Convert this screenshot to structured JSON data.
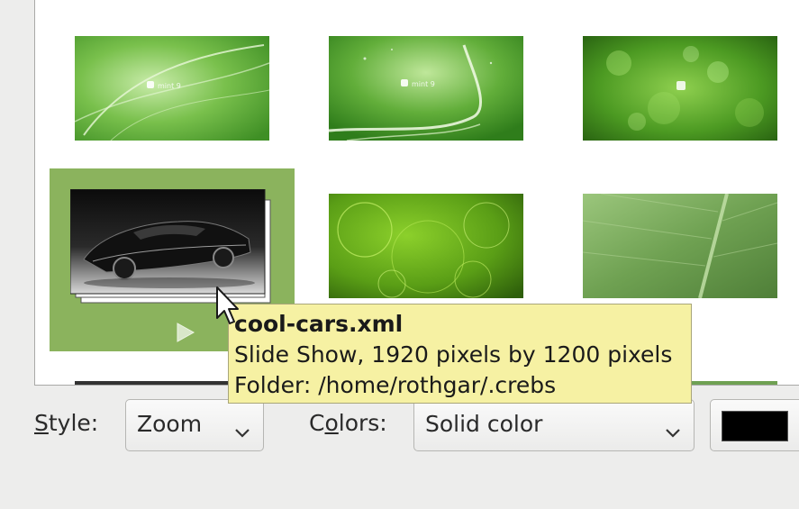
{
  "tooltip": {
    "title": "cool-cars.xml",
    "line1": "Slide Show, 1920 pixels by 1200 pixels",
    "line2": "Folder: /home/rothgar/.crebs"
  },
  "controls": {
    "style_label_pre": "",
    "style_label_mnemonic": "S",
    "style_label_post": "tyle:",
    "style_value": "Zoom",
    "colors_label_pre": "C",
    "colors_label_mnemonic": "o",
    "colors_label_post": "lors:",
    "colors_value": "Solid color",
    "color_swatch": "#000000"
  },
  "thumbnails": [
    {
      "name": "linux-mint-green-swirl",
      "color": "#7fbf5a"
    },
    {
      "name": "linux-mint-green-wave",
      "color": "#6fb24a"
    },
    {
      "name": "linux-mint-bokeh",
      "color": "#4d9a2e"
    },
    {
      "name": "cool-cars-slideshow",
      "color": "#111111"
    },
    {
      "name": "green-bubbles",
      "color": "#5c9e1e"
    },
    {
      "name": "green-leaf",
      "color": "#77a65a"
    }
  ],
  "icons": {
    "play": "play-icon",
    "cursor": "mouse-pointer-icon",
    "chevron": "chevron-down-icon"
  }
}
